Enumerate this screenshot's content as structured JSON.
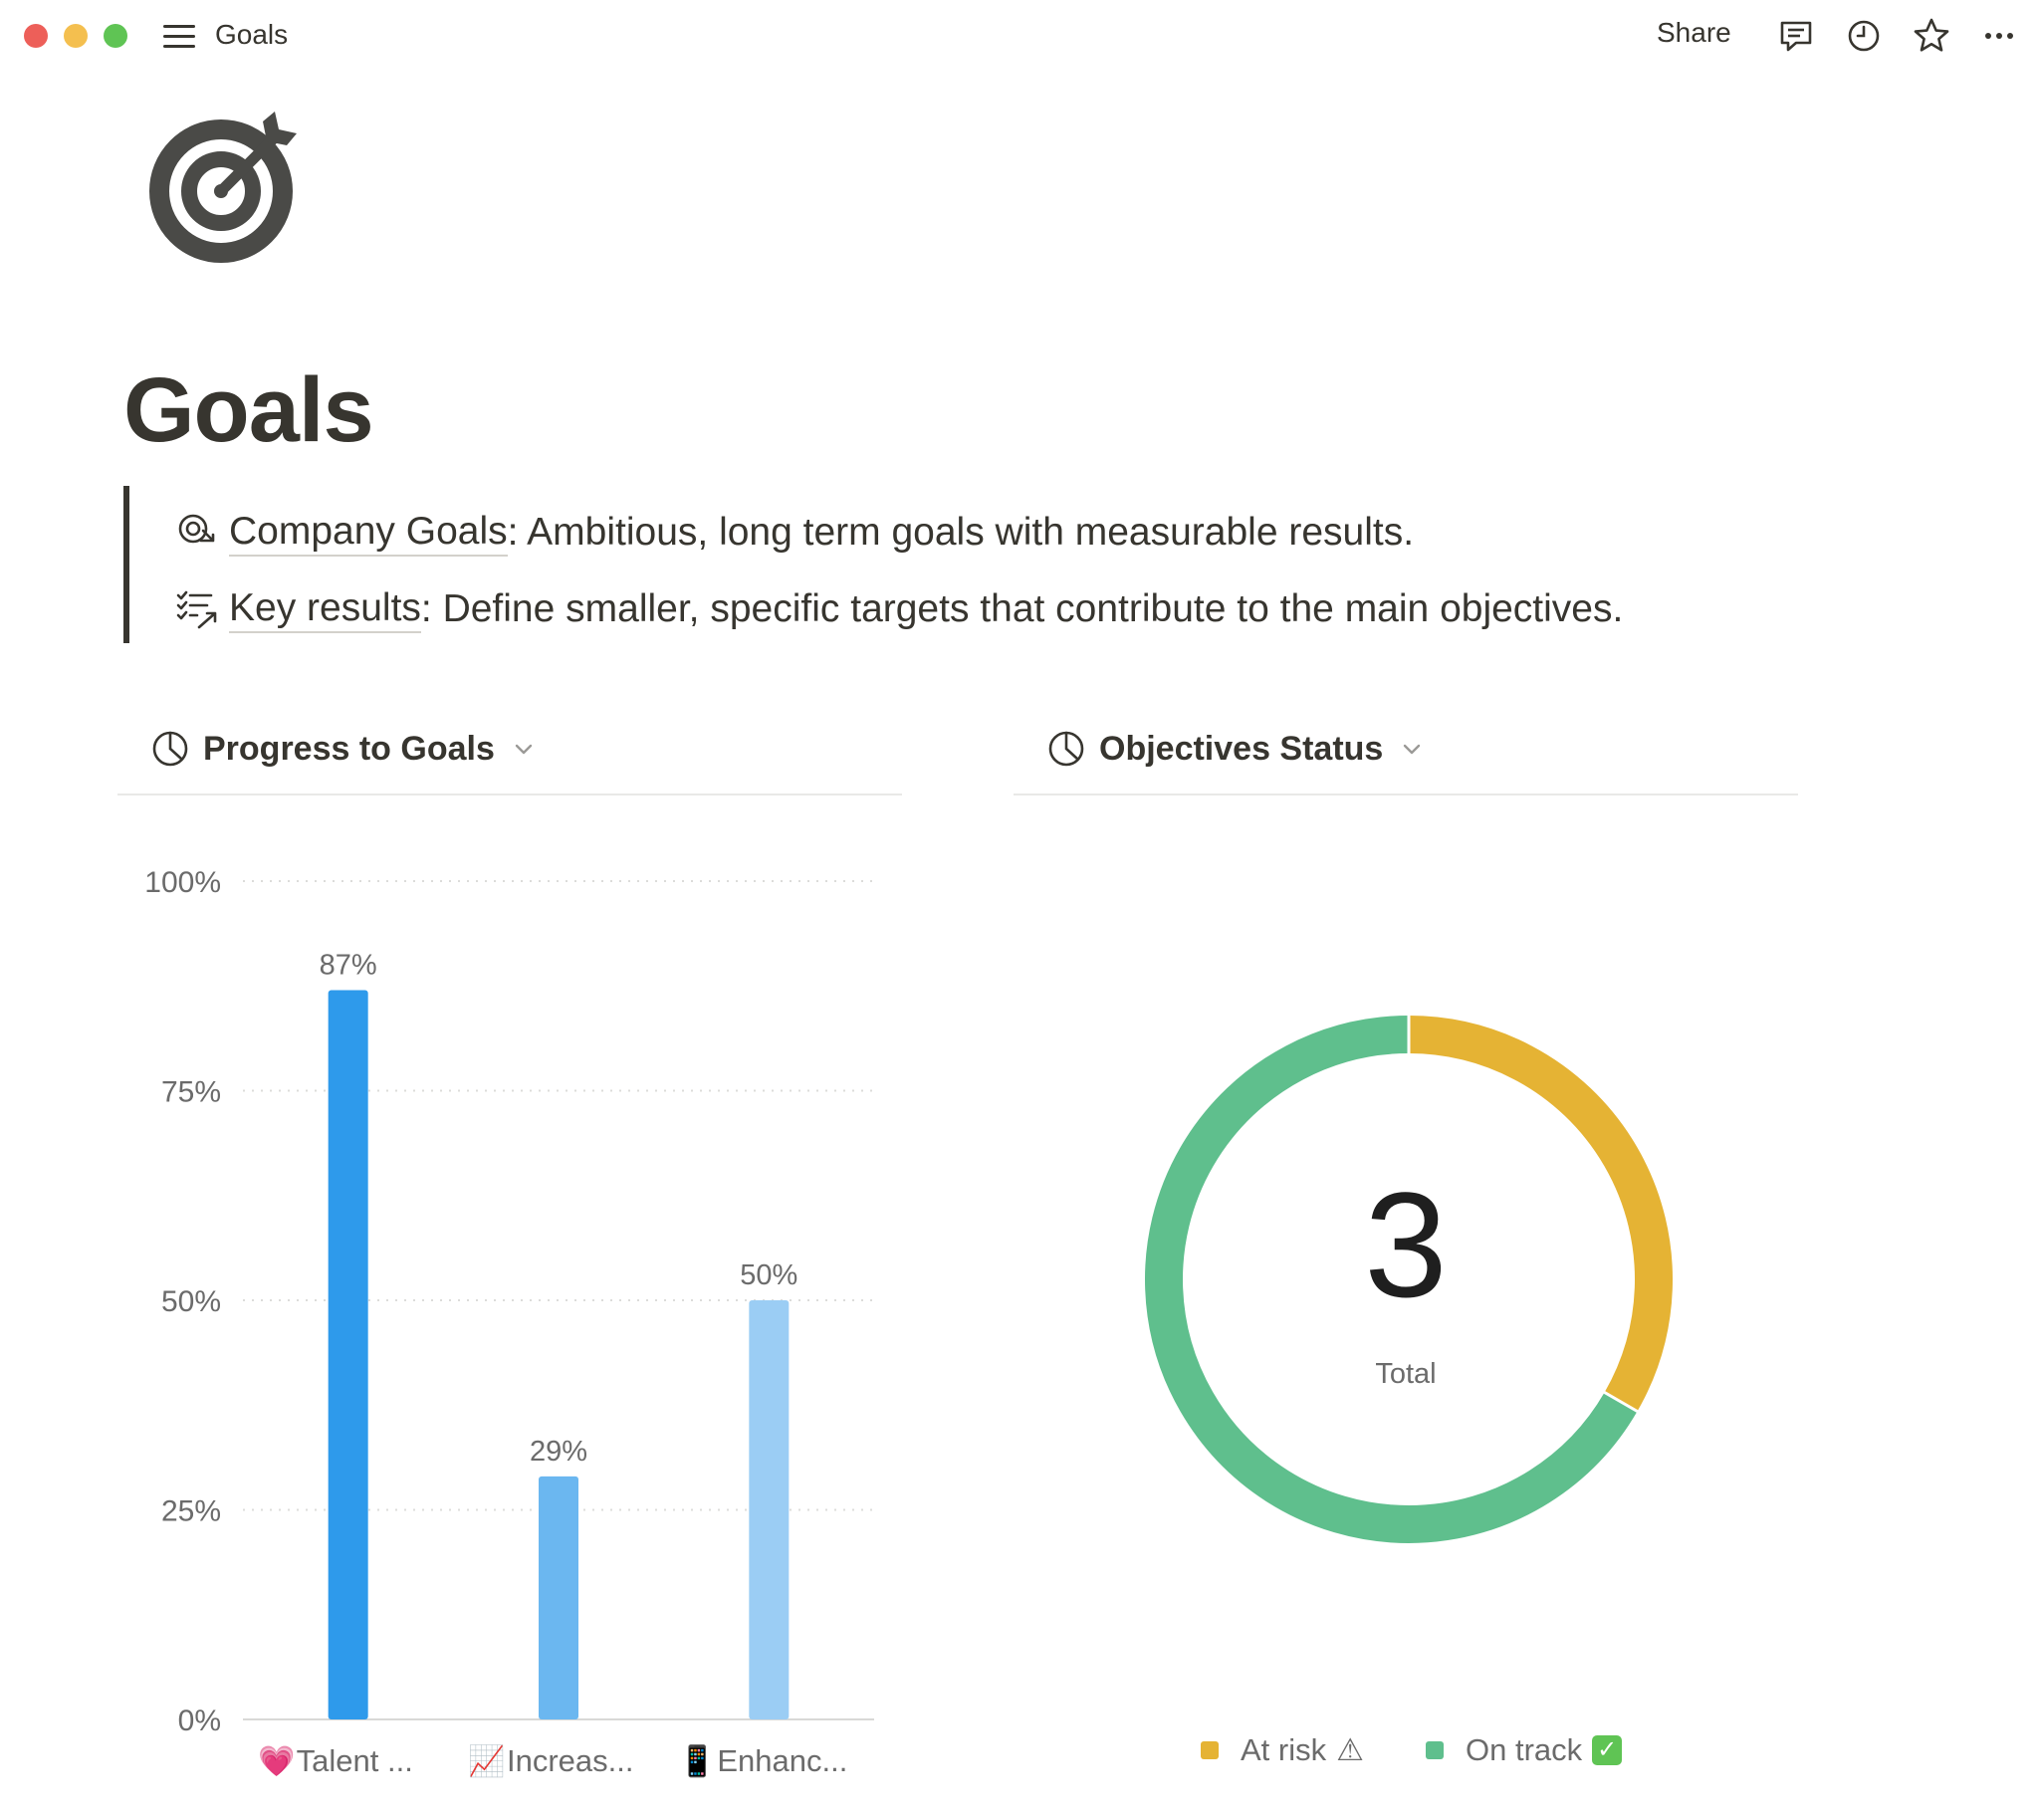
{
  "window": {
    "title": "Goals"
  },
  "toolbar": {
    "share_label": "Share"
  },
  "page": {
    "icon": "target-icon",
    "title": "Goals"
  },
  "callout": {
    "items": [
      {
        "icon": "target-arrow-icon",
        "link": "Company Goals",
        "text": ": Ambitious, long term goals with measurable results."
      },
      {
        "icon": "checklist-arrow-icon",
        "link": "Key results",
        "text": ": Define smaller, specific targets that contribute to the main objectives."
      }
    ]
  },
  "charts": {
    "progress": {
      "title": "Progress to Goals"
    },
    "status": {
      "title": "Objectives Status"
    }
  },
  "colors": {
    "bar_1": "#2e9aeb",
    "bar_2": "#6bb7f0",
    "bar_3": "#9bcdf4",
    "at_risk": "#e5b334",
    "on_track": "#5fbf8d"
  },
  "chart_data": [
    {
      "type": "bar",
      "title": "Progress to Goals",
      "categories": [
        "Talent ...",
        "Increas...",
        "Enhanc..."
      ],
      "category_icons": [
        "💗",
        "📈",
        "📱"
      ],
      "values": [
        87,
        29,
        50
      ],
      "value_labels": [
        "87%",
        "29%",
        "50%"
      ],
      "y_ticks": [
        "0%",
        "25%",
        "50%",
        "75%",
        "100%"
      ],
      "ylim": [
        0,
        100
      ],
      "grid": true
    },
    {
      "type": "pie",
      "title": "Objectives Status",
      "center_value": "3",
      "center_label": "Total",
      "series": [
        {
          "name": "At risk",
          "symbol": "⚠",
          "value": 1
        },
        {
          "name": "On track",
          "symbol": "✅",
          "value": 2
        }
      ],
      "legend": "bottom"
    }
  ]
}
